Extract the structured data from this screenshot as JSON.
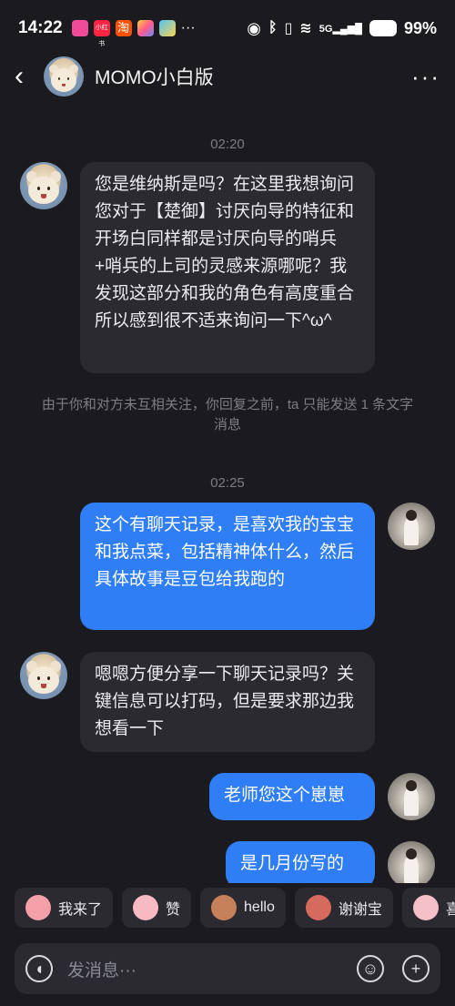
{
  "status": {
    "time": "14:22",
    "app_label": "小红书",
    "app_label2": "淘",
    "battery": "99%",
    "network": "5G"
  },
  "header": {
    "title": "MOMO小白版",
    "more": "···"
  },
  "messages": [
    {
      "type": "time",
      "text": "02:20"
    },
    {
      "type": "in",
      "text": "您是维纳斯是吗？在这里我想询问您对于【楚御】讨厌向导的特征和开场白同样都是讨厌向导的哨兵+哨兵的上司的灵感来源哪呢？我发现这部分和我的角色有高度重合所以感到很不适来询问一下^ω^"
    },
    {
      "type": "notice",
      "text": "由于你和对方未互相关注，你回复之前，ta 只能发送 1 条文字消息"
    },
    {
      "type": "time",
      "text": "02:25"
    },
    {
      "type": "out",
      "text": "这个有聊天记录，是喜欢我的宝宝和我点菜，包括精神体什么，然后具体故事是豆包给我跑的"
    },
    {
      "type": "in",
      "text": "嗯嗯方便分享一下聊天记录吗？关键信息可以打码，但是要求那边我想看一下"
    },
    {
      "type": "out",
      "text": "老师您这个崽崽"
    },
    {
      "type": "out",
      "text": "是几月份写的"
    }
  ],
  "quick_replies": [
    {
      "label": "我来了",
      "emoji": "pig-wave-emoji",
      "color": "#f3a0a8"
    },
    {
      "label": "赞",
      "emoji": "pig-thumb-emoji",
      "color": "#f7b9c2"
    },
    {
      "label": "hello",
      "emoji": "monkey-emoji",
      "color": "#c7815a"
    },
    {
      "label": "谢谢宝",
      "emoji": "pig-bow-emoji",
      "color": "#d66a5f"
    },
    {
      "label": "喜",
      "emoji": "pig-happy-emoji",
      "color": "#f5c0c8"
    }
  ],
  "input": {
    "placeholder": "发消息···"
  },
  "colors": {
    "background": "#1b1b1f",
    "bubble_in": "#2a2a30",
    "bubble_out": "#2f7ef5"
  }
}
